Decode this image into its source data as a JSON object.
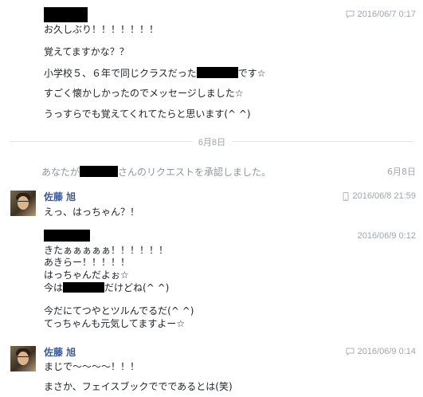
{
  "messages": {
    "m1": {
      "time": "2016/06/7 0:17",
      "lines": [
        "お久しぶり！！！！！！！",
        "覚えてますかな？？",
        "小学校５、６年で同じクラスだった",
        "です☆",
        "すごく懐かしかったのでメッセージしました☆",
        "うっすらでも覚えてくれてたらと思います(^ ^)"
      ]
    },
    "divider": {
      "label": "6月8日"
    },
    "system": {
      "prefix": "あなたが",
      "suffix": "さんのリクエストを承認しました。",
      "date": "6月8日"
    },
    "m2": {
      "sender": "佐藤 旭",
      "time": "2016/06/8 21:59",
      "lines": [
        "えっ、はっちゃん？！"
      ]
    },
    "m3": {
      "time": "2016/06/9 0:12",
      "lines": [
        "きたぁぁぁぁぁ！！！！！！",
        "あきらー！！！！！",
        "はっちゃんだよぉ☆",
        "今は",
        "だけどね(^ ^)",
        "今だにてつやとツルんでるだ(^ ^)",
        "てっちゃんも元気してますよー☆"
      ]
    },
    "m4": {
      "sender": "佐藤 旭",
      "time": "2016/06/9 0:14",
      "lines": [
        "まじで〜〜〜〜！！！",
        "まさか、フェイスブックででであるとは(笑)"
      ]
    }
  },
  "icons": {
    "message_time": "speech-bubble-icon",
    "mobile_time": "mobile-phone-icon"
  },
  "colors": {
    "sender_name": "#3b5998",
    "timestamp": "#a0a5ad",
    "system_text": "#90949c",
    "divider": "#e0e3e8"
  }
}
